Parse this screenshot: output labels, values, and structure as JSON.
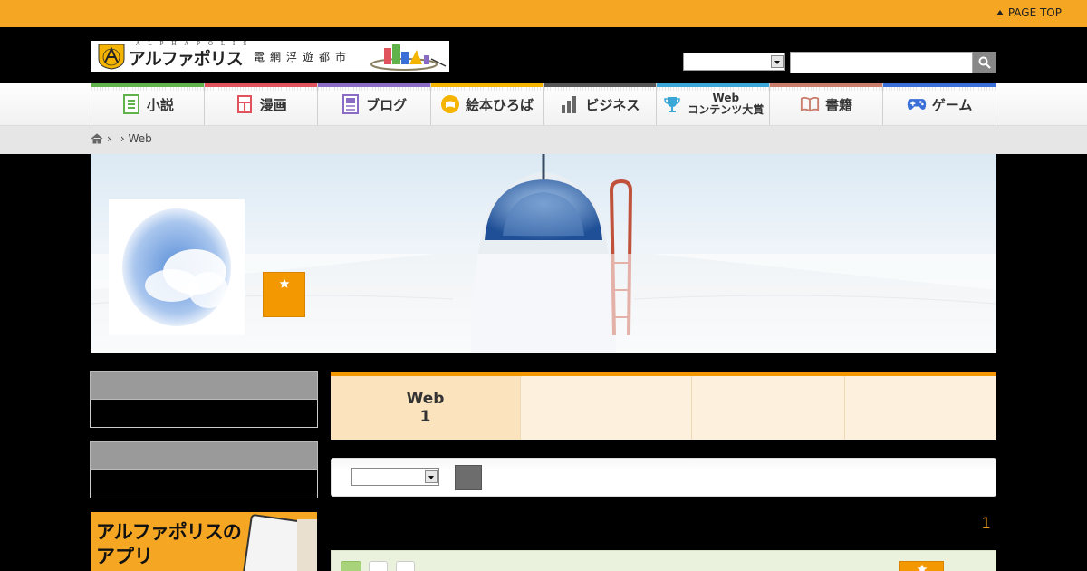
{
  "topbar": {
    "page_top_label": "PAGE TOP"
  },
  "header": {
    "logo_sub": "ALPHAPOLIS",
    "logo_name": "アルファポリス",
    "logo_city": "電網浮遊都市",
    "search": {
      "category_value": "",
      "query_value": "",
      "query_placeholder": ""
    }
  },
  "nav": {
    "items": [
      {
        "label": "小説",
        "icon": "novel-icon",
        "color": "#5fb34a"
      },
      {
        "label": "漫画",
        "icon": "manga-icon",
        "color": "#e0525c"
      },
      {
        "label": "ブログ",
        "icon": "blog-icon",
        "color": "#8a6cc4"
      },
      {
        "label": "絵本ひろば",
        "icon": "picturebook-icon",
        "color": "#f5b400"
      },
      {
        "label": "ビジネス",
        "icon": "business-icon",
        "color": "#555555"
      },
      {
        "label_line1": "Web",
        "label_line2": "コンテンツ大賞",
        "icon": "trophy-icon",
        "color": "#3aa7d8"
      },
      {
        "label": "書籍",
        "icon": "book-icon",
        "color": "#c97d6a"
      },
      {
        "label": "ゲーム",
        "icon": "gamepad-icon",
        "color": "#3a6fd8"
      }
    ]
  },
  "breadcrumb": {
    "sep1": "›",
    "sep2": "›",
    "current": "Web"
  },
  "profile": {
    "favorite_icon": "star-icon"
  },
  "main": {
    "tabs": [
      {
        "line1": "Web",
        "line2": "1"
      },
      {
        "line1": "",
        "line2": ""
      },
      {
        "line1": "",
        "line2": ""
      },
      {
        "line1": "",
        "line2": ""
      }
    ],
    "filter": {
      "sort_value": ""
    },
    "result_count": "1"
  },
  "sidebar": {
    "app_banner_line1": "アルファポリスの",
    "app_banner_line2": "アプリ"
  },
  "colors": {
    "accent": "#f39800",
    "topbar": "#f5a623",
    "tab_bg": "#fdf0dc"
  }
}
